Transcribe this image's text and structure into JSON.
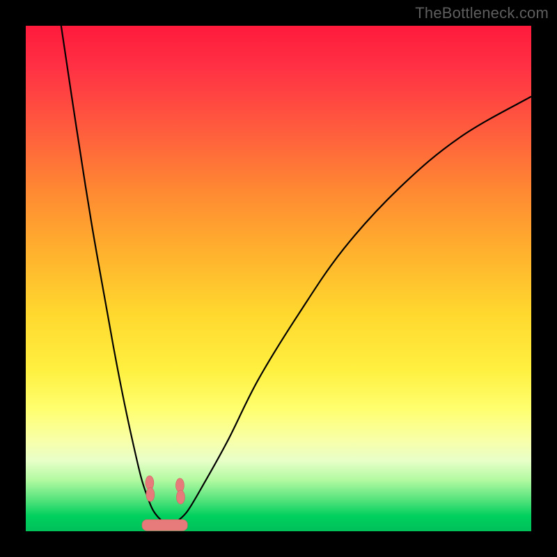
{
  "watermark": "TheBottleneck.com",
  "colors": {
    "frame": "#000000",
    "gradient_top": "#ff1a3c",
    "gradient_bottom": "#00c05a",
    "curve": "#000000",
    "marker": "#e77b7b"
  },
  "chart_data": {
    "type": "line",
    "title": "",
    "xlabel": "",
    "ylabel": "",
    "xlim": [
      0,
      100
    ],
    "ylim": [
      0,
      100
    ],
    "series": [
      {
        "name": "left-branch",
        "x": [
          7,
          10,
          13,
          16,
          18,
          20,
          22,
          23,
          24,
          25,
          26,
          27
        ],
        "y": [
          100,
          80,
          61,
          44,
          33,
          23,
          14,
          10,
          7,
          4.5,
          3,
          2
        ]
      },
      {
        "name": "right-branch",
        "x": [
          30,
          32,
          35,
          40,
          46,
          54,
          63,
          74,
          86,
          100
        ],
        "y": [
          2,
          4,
          9,
          18,
          30,
          43,
          56,
          68,
          78,
          86
        ]
      }
    ],
    "markers": [
      {
        "name": "left-marker",
        "x": 24.5,
        "y": 8.5
      },
      {
        "name": "right-marker",
        "x": 30.5,
        "y": 8.0
      }
    ],
    "bottom_pill": {
      "x_center": 27.5,
      "y": 1.2,
      "width": 9,
      "height": 2.2
    }
  }
}
